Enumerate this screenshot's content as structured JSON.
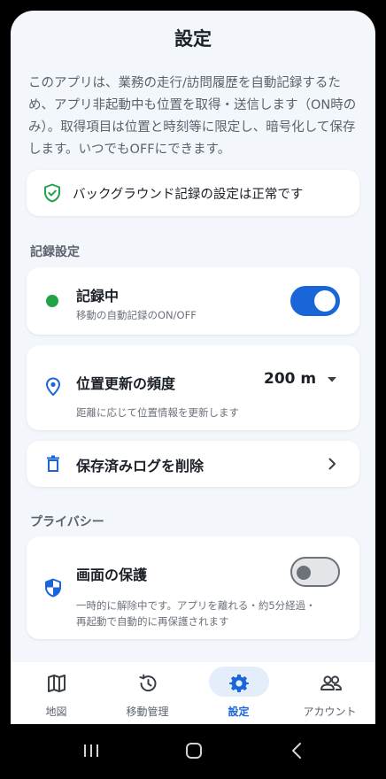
{
  "header": {
    "title": "設定"
  },
  "intro": {
    "text": "このアプリは、業務の走行/訪問履歴を自動記録するため、アプリ非起動中も位置を取得・送信します（ON時のみ）。取得項目は位置と時刻等に限定し、暗号化して保存します。いつでもOFFにできます。"
  },
  "status_card": {
    "text": "バックグラウンド記録の設定は正常です",
    "icon": "shield-check-icon"
  },
  "record_section": {
    "label": "記録設定"
  },
  "recording": {
    "title": "記録中",
    "subtitle": "移動の自動記録のON/OFF",
    "enabled": true,
    "dot_color": "#22a34a"
  },
  "frequency": {
    "title": "位置更新の頻度",
    "value": "200 m",
    "subtitle": "距離に応じて位置情報を更新します",
    "icon": "location-pin-icon"
  },
  "delete_logs": {
    "title": "保存済みログを削除",
    "icon": "trash-icon"
  },
  "privacy_section": {
    "label": "プライバシー"
  },
  "screen_protect": {
    "title": "画面の保護",
    "enabled": false,
    "subtitle_line1": "一時的に解除中です。アプリを離れる・約5分経過・",
    "subtitle_line2": "再起動で自動的に再保護されます",
    "icon": "shield-half-icon"
  },
  "nav": {
    "items": [
      {
        "label": "地図",
        "icon": "map-icon",
        "active": false
      },
      {
        "label": "移動管理",
        "icon": "history-icon",
        "active": false
      },
      {
        "label": "設定",
        "icon": "gear-icon",
        "active": true
      },
      {
        "label": "アカウント",
        "icon": "people-icon",
        "active": false
      }
    ]
  },
  "colors": {
    "accent": "#1a66d9",
    "success": "#22a34a",
    "background": "#f3f6fb"
  }
}
